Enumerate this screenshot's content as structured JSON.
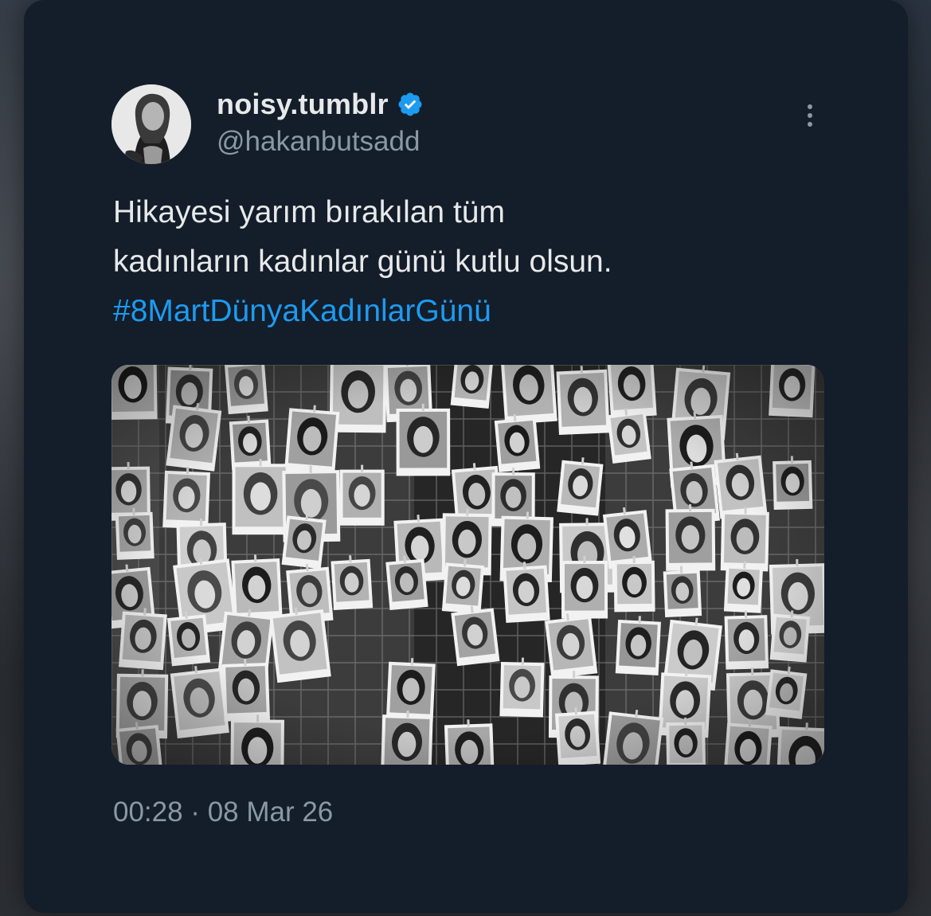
{
  "tweet": {
    "display_name": "noisy.tumblr",
    "handle": "@hakanbutsadd",
    "verified": true,
    "text_lines": [
      "Hikayesi yarım bırakılan tüm",
      "kadınların kadınlar günü kutlu olsun."
    ],
    "hashtag": "#8MartDünyaKadınlarGünü",
    "timestamp": "00:28 · 08 Mar 26",
    "image_description_icon": "photo-wall-image"
  },
  "colors": {
    "card_background": "#141d2a",
    "text_primary": "#e7e9ea",
    "text_secondary": "#8b98a5",
    "accent": "#1d9bf0"
  }
}
